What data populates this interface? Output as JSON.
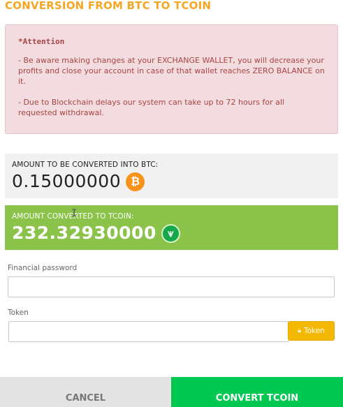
{
  "title": "CONVERSION FROM BTC TO TCOIN",
  "alert": {
    "heading": "*Attention",
    "line1": "- Be aware making changes at your EXCHANGE WALLET, you will decrease your profits and close your account in case of that wallet reaches ZERO BALANCE on it.",
    "line2": "- Due to Blockchain delays our system can take up to 72 hours for all requested withdrawal."
  },
  "btc_amount": {
    "label": "AMOUNT TO BE CONVERTED INTO BTC:",
    "value": "0.15000000",
    "icon": "bitcoin-icon",
    "icon_glyph": "₿",
    "icon_color": "#f7931a"
  },
  "tcoin_amount": {
    "label": "AMOUNT CONVERTED TO TCOIN:",
    "value": "232.32930000",
    "icon": "tcoin-icon",
    "icon_glyph": "♈",
    "icon_color": "#14a84a",
    "box_color": "#8bc34a"
  },
  "financial_password": {
    "label": "Financial password",
    "value": "",
    "placeholder": ""
  },
  "token": {
    "label": "Token",
    "value": "",
    "placeholder": "",
    "button_label": "Token",
    "button_icon": "lock-icon"
  },
  "actions": {
    "cancel_label": "CANCEL",
    "convert_label": "CONVERT TCOIN",
    "convert_color": "#00c853"
  },
  "colors": {
    "accent": "#f5a623",
    "alert_bg": "#f3dcdf",
    "alert_text": "#a94442"
  }
}
